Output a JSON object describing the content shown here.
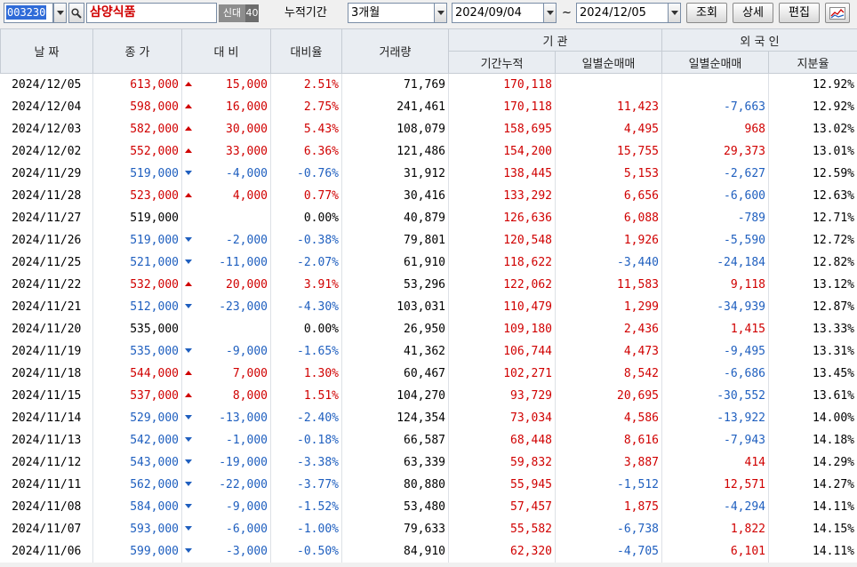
{
  "toolbar": {
    "stock_code": "003230",
    "stock_name": "삼양식품",
    "badge_credit": "신대",
    "badge_margin": "40",
    "period_label": "누적기간",
    "period_value": "3개월",
    "date_start": "2024/09/04",
    "date_separator": "~",
    "date_end": "2024/12/05",
    "query_label": "조회",
    "detail_label": "상세",
    "edit_label": "편집"
  },
  "headers": {
    "date": "날 짜",
    "close": "종 가",
    "change": "대 비",
    "change_rate": "대비율",
    "volume": "거래량",
    "institution": "기 관",
    "inst_cumulative": "기간누적",
    "inst_daily_net": "일별순매매",
    "foreign": "외 국 인",
    "foreign_daily_net": "일별순매매",
    "foreign_share": "지분율"
  },
  "colors": {
    "up": "#d00000",
    "down": "#1f5fbf",
    "header_bg": "#e9edf2"
  },
  "rows": [
    {
      "date": "2024/12/05",
      "close": "613,000",
      "dir": "up",
      "change": "15,000",
      "rate": "2.51%",
      "volume": "71,769",
      "inst_cum": "170,118",
      "inst_net": "",
      "fgn_net": "",
      "fgn_share": "12.92%"
    },
    {
      "date": "2024/12/04",
      "close": "598,000",
      "dir": "up",
      "change": "16,000",
      "rate": "2.75%",
      "volume": "241,461",
      "inst_cum": "170,118",
      "inst_net": "11,423",
      "fgn_net": "-7,663",
      "fgn_share": "12.92%"
    },
    {
      "date": "2024/12/03",
      "close": "582,000",
      "dir": "up",
      "change": "30,000",
      "rate": "5.43%",
      "volume": "108,079",
      "inst_cum": "158,695",
      "inst_net": "4,495",
      "fgn_net": "968",
      "fgn_share": "13.02%"
    },
    {
      "date": "2024/12/02",
      "close": "552,000",
      "dir": "up",
      "change": "33,000",
      "rate": "6.36%",
      "volume": "121,486",
      "inst_cum": "154,200",
      "inst_net": "15,755",
      "fgn_net": "29,373",
      "fgn_share": "13.01%"
    },
    {
      "date": "2024/11/29",
      "close": "519,000",
      "dir": "down",
      "change": "-4,000",
      "rate": "-0.76%",
      "volume": "31,912",
      "inst_cum": "138,445",
      "inst_net": "5,153",
      "fgn_net": "-2,627",
      "fgn_share": "12.59%"
    },
    {
      "date": "2024/11/28",
      "close": "523,000",
      "dir": "up",
      "change": "4,000",
      "rate": "0.77%",
      "volume": "30,416",
      "inst_cum": "133,292",
      "inst_net": "6,656",
      "fgn_net": "-6,600",
      "fgn_share": "12.63%"
    },
    {
      "date": "2024/11/27",
      "close": "519,000",
      "dir": "flat",
      "change": "",
      "rate": "0.00%",
      "volume": "40,879",
      "inst_cum": "126,636",
      "inst_net": "6,088",
      "fgn_net": "-789",
      "fgn_share": "12.71%"
    },
    {
      "date": "2024/11/26",
      "close": "519,000",
      "dir": "down",
      "change": "-2,000",
      "rate": "-0.38%",
      "volume": "79,801",
      "inst_cum": "120,548",
      "inst_net": "1,926",
      "fgn_net": "-5,590",
      "fgn_share": "12.72%"
    },
    {
      "date": "2024/11/25",
      "close": "521,000",
      "dir": "down",
      "change": "-11,000",
      "rate": "-2.07%",
      "volume": "61,910",
      "inst_cum": "118,622",
      "inst_net": "-3,440",
      "fgn_net": "-24,184",
      "fgn_share": "12.82%"
    },
    {
      "date": "2024/11/22",
      "close": "532,000",
      "dir": "up",
      "change": "20,000",
      "rate": "3.91%",
      "volume": "53,296",
      "inst_cum": "122,062",
      "inst_net": "11,583",
      "fgn_net": "9,118",
      "fgn_share": "13.12%"
    },
    {
      "date": "2024/11/21",
      "close": "512,000",
      "dir": "down",
      "change": "-23,000",
      "rate": "-4.30%",
      "volume": "103,031",
      "inst_cum": "110,479",
      "inst_net": "1,299",
      "fgn_net": "-34,939",
      "fgn_share": "12.87%"
    },
    {
      "date": "2024/11/20",
      "close": "535,000",
      "dir": "flat",
      "change": "",
      "rate": "0.00%",
      "volume": "26,950",
      "inst_cum": "109,180",
      "inst_net": "2,436",
      "fgn_net": "1,415",
      "fgn_share": "13.33%"
    },
    {
      "date": "2024/11/19",
      "close": "535,000",
      "dir": "down",
      "change": "-9,000",
      "rate": "-1.65%",
      "volume": "41,362",
      "inst_cum": "106,744",
      "inst_net": "4,473",
      "fgn_net": "-9,495",
      "fgn_share": "13.31%"
    },
    {
      "date": "2024/11/18",
      "close": "544,000",
      "dir": "up",
      "change": "7,000",
      "rate": "1.30%",
      "volume": "60,467",
      "inst_cum": "102,271",
      "inst_net": "8,542",
      "fgn_net": "-6,686",
      "fgn_share": "13.45%"
    },
    {
      "date": "2024/11/15",
      "close": "537,000",
      "dir": "up",
      "change": "8,000",
      "rate": "1.51%",
      "volume": "104,270",
      "inst_cum": "93,729",
      "inst_net": "20,695",
      "fgn_net": "-30,552",
      "fgn_share": "13.61%"
    },
    {
      "date": "2024/11/14",
      "close": "529,000",
      "dir": "down",
      "change": "-13,000",
      "rate": "-2.40%",
      "volume": "124,354",
      "inst_cum": "73,034",
      "inst_net": "4,586",
      "fgn_net": "-13,922",
      "fgn_share": "14.00%"
    },
    {
      "date": "2024/11/13",
      "close": "542,000",
      "dir": "down",
      "change": "-1,000",
      "rate": "-0.18%",
      "volume": "66,587",
      "inst_cum": "68,448",
      "inst_net": "8,616",
      "fgn_net": "-7,943",
      "fgn_share": "14.18%"
    },
    {
      "date": "2024/11/12",
      "close": "543,000",
      "dir": "down",
      "change": "-19,000",
      "rate": "-3.38%",
      "volume": "63,339",
      "inst_cum": "59,832",
      "inst_net": "3,887",
      "fgn_net": "414",
      "fgn_share": "14.29%"
    },
    {
      "date": "2024/11/11",
      "close": "562,000",
      "dir": "down",
      "change": "-22,000",
      "rate": "-3.77%",
      "volume": "80,880",
      "inst_cum": "55,945",
      "inst_net": "-1,512",
      "fgn_net": "12,571",
      "fgn_share": "14.27%"
    },
    {
      "date": "2024/11/08",
      "close": "584,000",
      "dir": "down",
      "change": "-9,000",
      "rate": "-1.52%",
      "volume": "53,480",
      "inst_cum": "57,457",
      "inst_net": "1,875",
      "fgn_net": "-4,294",
      "fgn_share": "14.11%"
    },
    {
      "date": "2024/11/07",
      "close": "593,000",
      "dir": "down",
      "change": "-6,000",
      "rate": "-1.00%",
      "volume": "79,633",
      "inst_cum": "55,582",
      "inst_net": "-6,738",
      "fgn_net": "1,822",
      "fgn_share": "14.15%"
    },
    {
      "date": "2024/11/06",
      "close": "599,000",
      "dir": "down",
      "change": "-3,000",
      "rate": "-0.50%",
      "volume": "84,910",
      "inst_cum": "62,320",
      "inst_net": "-4,705",
      "fgn_net": "6,101",
      "fgn_share": "14.11%"
    }
  ]
}
